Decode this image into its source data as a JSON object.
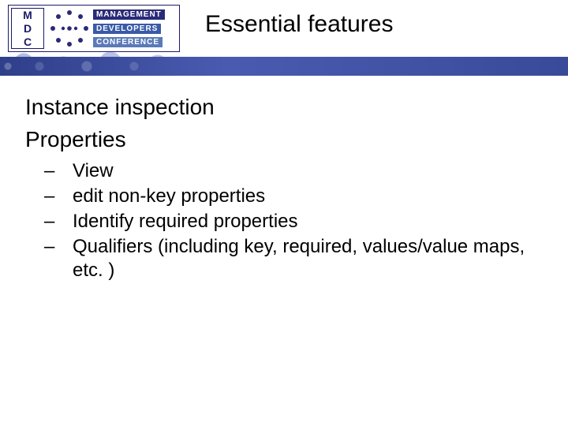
{
  "logo": {
    "letters": [
      "M",
      "D",
      "C"
    ],
    "words": [
      "MANAGEMENT",
      "DEVELOPERS",
      "CONFERENCE"
    ]
  },
  "title": "Essential features",
  "body": {
    "heading": [
      "Instance inspection",
      "Properties"
    ],
    "bullets": [
      "View",
      "edit non-key properties",
      "Identify required properties",
      "Qualifiers (including key, required, values/value maps, etc. )"
    ]
  }
}
